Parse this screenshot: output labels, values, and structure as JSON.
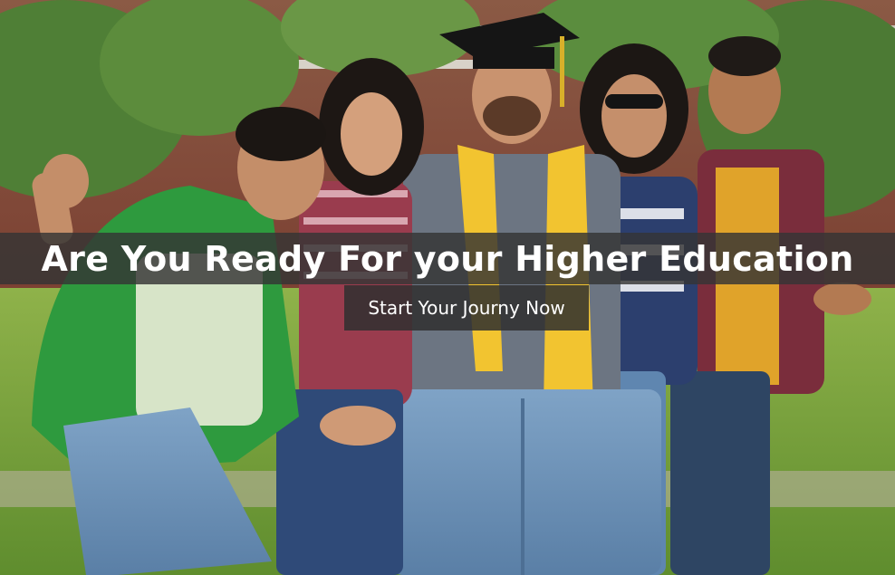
{
  "hero": {
    "headline": "Are You Ready For your Higher Education",
    "cta_label": "Start Your Journy Now"
  },
  "colors": {
    "band_overlay": "#343434",
    "cta_background": "#303030",
    "text": "#ffffff"
  }
}
